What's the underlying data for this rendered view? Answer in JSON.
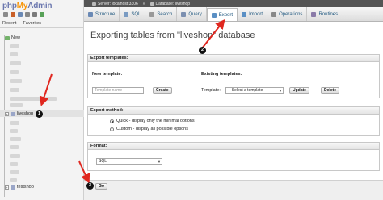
{
  "left": {
    "logo": {
      "php": "php",
      "my": "My",
      "admin": "Admin"
    },
    "quick_icons": [
      "home-icon",
      "exit-icon",
      "query-icon",
      "docs-icon",
      "settings-icon",
      "reload-icon"
    ],
    "tabs": [
      "Recent",
      "Favorites"
    ],
    "new_label": "New",
    "selected_db": "liveshop",
    "other_db": "testshop"
  },
  "serverbar": {
    "server": "Server: localhost:3306",
    "database": "Database: liveshop"
  },
  "tabs": [
    {
      "label": "Structure",
      "icon": "structure-icon"
    },
    {
      "label": "SQL",
      "icon": "sql-icon"
    },
    {
      "label": "Search",
      "icon": "search-icon"
    },
    {
      "label": "Query",
      "icon": "query-icon"
    },
    {
      "label": "Export",
      "icon": "export-icon",
      "active": true
    },
    {
      "label": "Import",
      "icon": "import-icon"
    },
    {
      "label": "Operations",
      "icon": "operations-icon"
    },
    {
      "label": "Routines",
      "icon": "routines-icon"
    }
  ],
  "main": {
    "title": "Exporting tables from \"liveshop\" database",
    "templates": {
      "heading": "Export templates:",
      "new_template_label": "New template:",
      "template_name_placeholder": "Template name",
      "create_label": "Create",
      "existing_label": "Existing templates:",
      "template_label": "Template:",
      "template_select": "-- Select a template --",
      "update_label": "Update",
      "delete_label": "Delete"
    },
    "method": {
      "heading": "Export method:",
      "options": [
        {
          "label": "Quick - display only the minimal options",
          "selected": true
        },
        {
          "label": "Custom - display all possible options",
          "selected": false
        }
      ]
    },
    "format": {
      "heading": "Format:",
      "value": "SQL"
    },
    "go_label": "Go"
  },
  "annotations": {
    "step1": "1",
    "step2": "2",
    "step3": "3"
  },
  "colors": {
    "arrow": "#e0271f",
    "accent_link": "#235a81"
  }
}
